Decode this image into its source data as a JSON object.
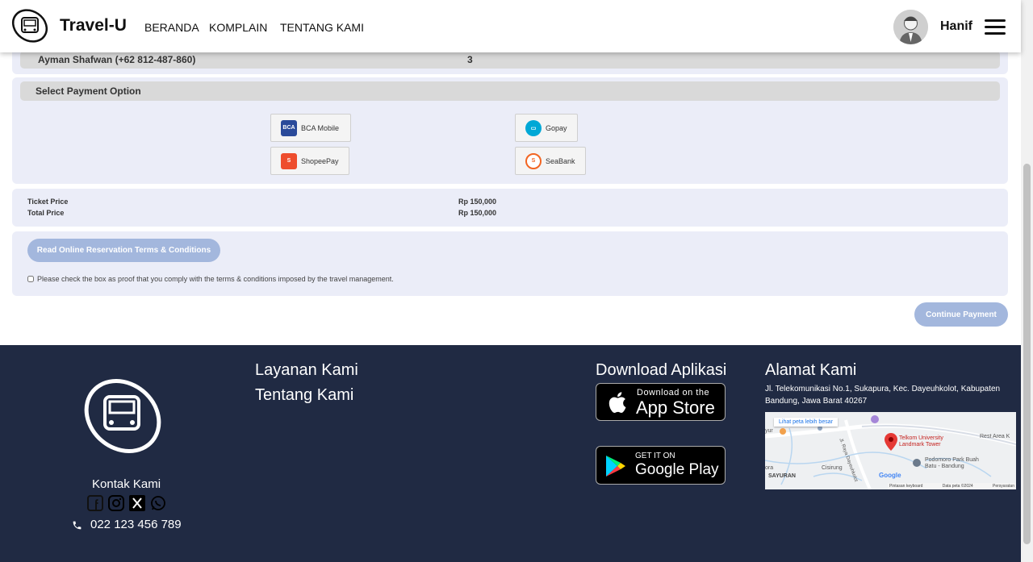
{
  "navbar": {
    "brand": "Travel-U",
    "links": [
      "BERANDA",
      "KOMPLAIN",
      "TENTANG KAMI"
    ],
    "username": "Hanif"
  },
  "passenger": {
    "name": "Ayman Shafwan (+62 812-487-860)",
    "seat": "3"
  },
  "payment": {
    "title": "Select Payment Option",
    "options": [
      {
        "label": "BCA Mobile",
        "icon": "bca-mobile-icon",
        "color": "#2a4a9a"
      },
      {
        "label": "Gopay",
        "icon": "gopay-icon",
        "color": "#00a8d6"
      },
      {
        "label": "ShopeePay",
        "icon": "shopeepay-icon",
        "color": "#ee4d2d"
      },
      {
        "label": "SeaBank",
        "icon": "seabank-icon",
        "color": "#f26522"
      }
    ]
  },
  "prices": {
    "ticket_label": "Ticket Price",
    "ticket_value": "Rp 150,000",
    "total_label": "Total Price",
    "total_value": "Rp 150,000"
  },
  "terms": {
    "button": "Read Online Reservation Terms & Conditions",
    "checkbox_text": "Please check the box as proof that you comply with the terms & conditions imposed by the travel management."
  },
  "continue_button": "Continue Payment",
  "footer": {
    "contact_title": "Kontak Kami",
    "phone": "022 123 456 789",
    "links": [
      "Layanan Kami",
      "Tentang Kami"
    ],
    "download_title": "Download Aplikasi",
    "appstore_small": "Download on the",
    "appstore_big": "App Store",
    "play_small": "GET IT ON",
    "play_big": "Google Play",
    "address_title": "Alamat Kami",
    "address": "Jl. Telekomunikasi No.1, Sukapura, Kec. Dayeuhkolot, Kabupaten Bandung, Jawa Barat 40267",
    "map": {
      "larger_map": "Lihat peta lebih besar",
      "place": "Telkom University Landmark Tower",
      "labels": [
        "Rest Area K",
        "Podomoro Park Buah Batu - Bandung",
        "SAYURAN",
        "Jl. Raya Dayeuhkolot",
        "Cisirung",
        "ora",
        "yur"
      ],
      "google": "Google",
      "footer_items": [
        "Pintasan keyboard",
        "Data peta ©2024",
        "Persyaratan"
      ]
    }
  },
  "colors": {
    "panel": "#ebedf8",
    "accent_disabled": "#a3b7dd",
    "footer": "#202a43"
  }
}
